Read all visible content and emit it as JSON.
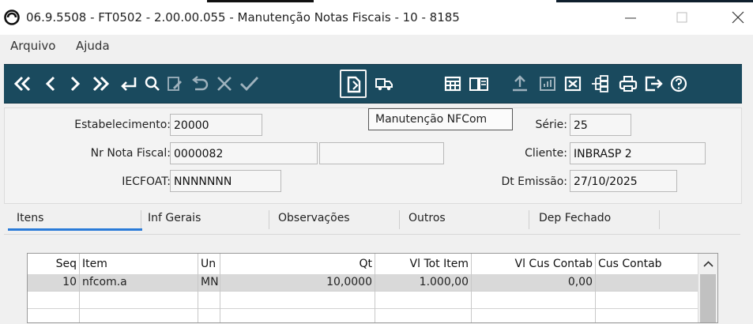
{
  "window": {
    "title": "06.9.5508 - FT0502 - 2.00.00.055 - Manutenção Notas Fiscais - 10 - 8185",
    "icon": "app-logo-icon",
    "controls": [
      "minimize-icon",
      "maximize-icon",
      "close-icon"
    ]
  },
  "menu": {
    "file": "Arquivo",
    "help": "Ajuda"
  },
  "toolbar": {
    "accent": "#1a4a5e",
    "buttons": [
      "first-icon",
      "previous-icon",
      "next-icon",
      "last-icon",
      "goto-icon",
      "search-icon",
      "edit-icon",
      "undo-icon",
      "cancel-icon",
      "confirm-icon",
      "document-icon",
      "truck-icon",
      "grid-icon",
      "book-icon",
      "upload-icon",
      "chart-icon",
      "delete-icon",
      "tree-icon",
      "print-icon",
      "exit-icon",
      "help-icon"
    ]
  },
  "tooltip": "Manutenção NFCom",
  "form": {
    "estabelecimento_label": "Estabelecimento:",
    "estabelecimento_value": "20000",
    "nota_label": "Nr Nota Fiscal:",
    "nota_value": "0000082",
    "nota_extra_value": "",
    "iecfoat_label": "IECFOAT:",
    "iecfoat_value": "NNNNNNN",
    "serie_label": "Série:",
    "serie_value": "25",
    "cliente_label": "Cliente:",
    "cliente_value": "INBRASP  2",
    "emissao_label": "Dt Emissão:",
    "emissao_value": "27/10/2025"
  },
  "tabs": [
    {
      "label": "Itens"
    },
    {
      "label": "Inf Gerais"
    },
    {
      "label": "Observações"
    },
    {
      "label": "Outros"
    },
    {
      "label": "Dep Fechado"
    }
  ],
  "grid": {
    "headers": [
      "Seq",
      "Item",
      "Un",
      "Qt",
      "Vl Tot Item",
      "Vl Cus Contab",
      "Cus Contab"
    ],
    "rows": [
      [
        "10",
        "nfcom.a",
        "MN",
        "10,0000",
        "1.000,00",
        "0,00",
        ""
      ]
    ]
  }
}
